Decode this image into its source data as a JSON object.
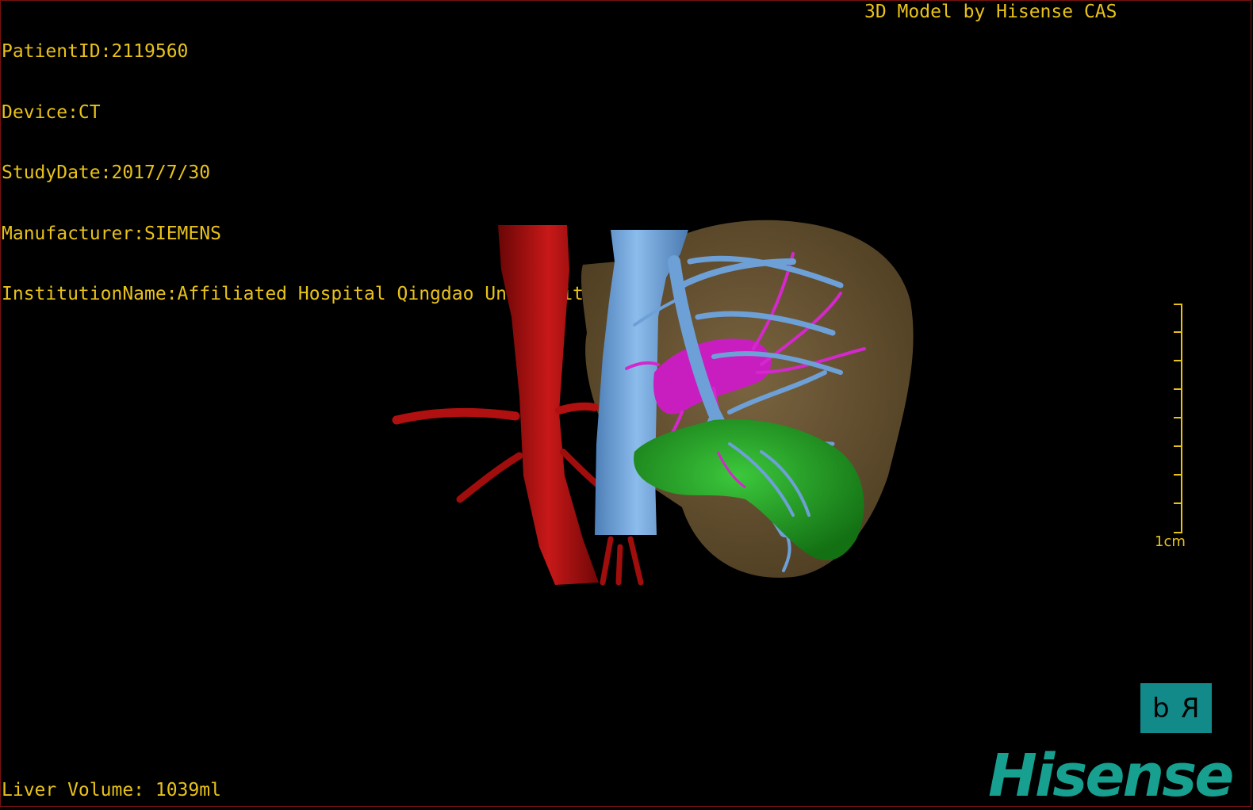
{
  "overlay": {
    "patient_id": "PatientID:2119560",
    "device": "Device:CT",
    "study_date": "StudyDate:2017/7/30",
    "manufacturer": "Manufacturer:SIEMENS",
    "institution": "InstitutionName:Affiliated Hospital Qingdao University-C",
    "model_title": "3D Model by Hisense CAS",
    "liver_volume": "Liver Volume: 1039ml"
  },
  "scale_bar": {
    "label": "1cm",
    "ticks": 9
  },
  "orientation": {
    "left": "d",
    "right": "R"
  },
  "brand": {
    "logo_text": "Hisense"
  },
  "colors": {
    "text": "#e8c21a",
    "liver": "#6b5533",
    "aorta": "#b01010",
    "vena_cava": "#6ea0d8",
    "portal": "#d020c8",
    "tumor": "#1e9a1e",
    "orientation_box": "#138a8a",
    "brand": "#17a08f"
  }
}
